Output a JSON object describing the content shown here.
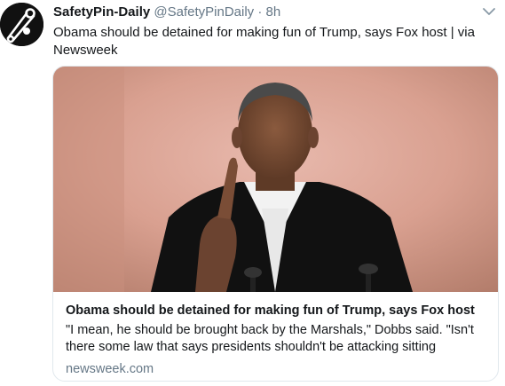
{
  "tweet": {
    "display_name": "SafetyPin-Daily",
    "handle": "@SafetyPinDaily",
    "separator": "·",
    "time": "8h",
    "text": "Obama should be detained for making fun of Trump, says Fox host | via Newsweek",
    "avatar_icon": "safety-pin-logo-icon",
    "menu_icon": "chevron-down-icon"
  },
  "card": {
    "title": "Obama should be detained for making fun of Trump, says Fox host",
    "description": "\"I mean, he should be brought back by the Marshals,\" Dobbs said. \"Isn't there some law that says presidents shouldn't be attacking sitting",
    "domain": "newsweek.com"
  },
  "colors": {
    "text": "#14171a",
    "muted": "#657786",
    "border": "#e1e8ed"
  }
}
